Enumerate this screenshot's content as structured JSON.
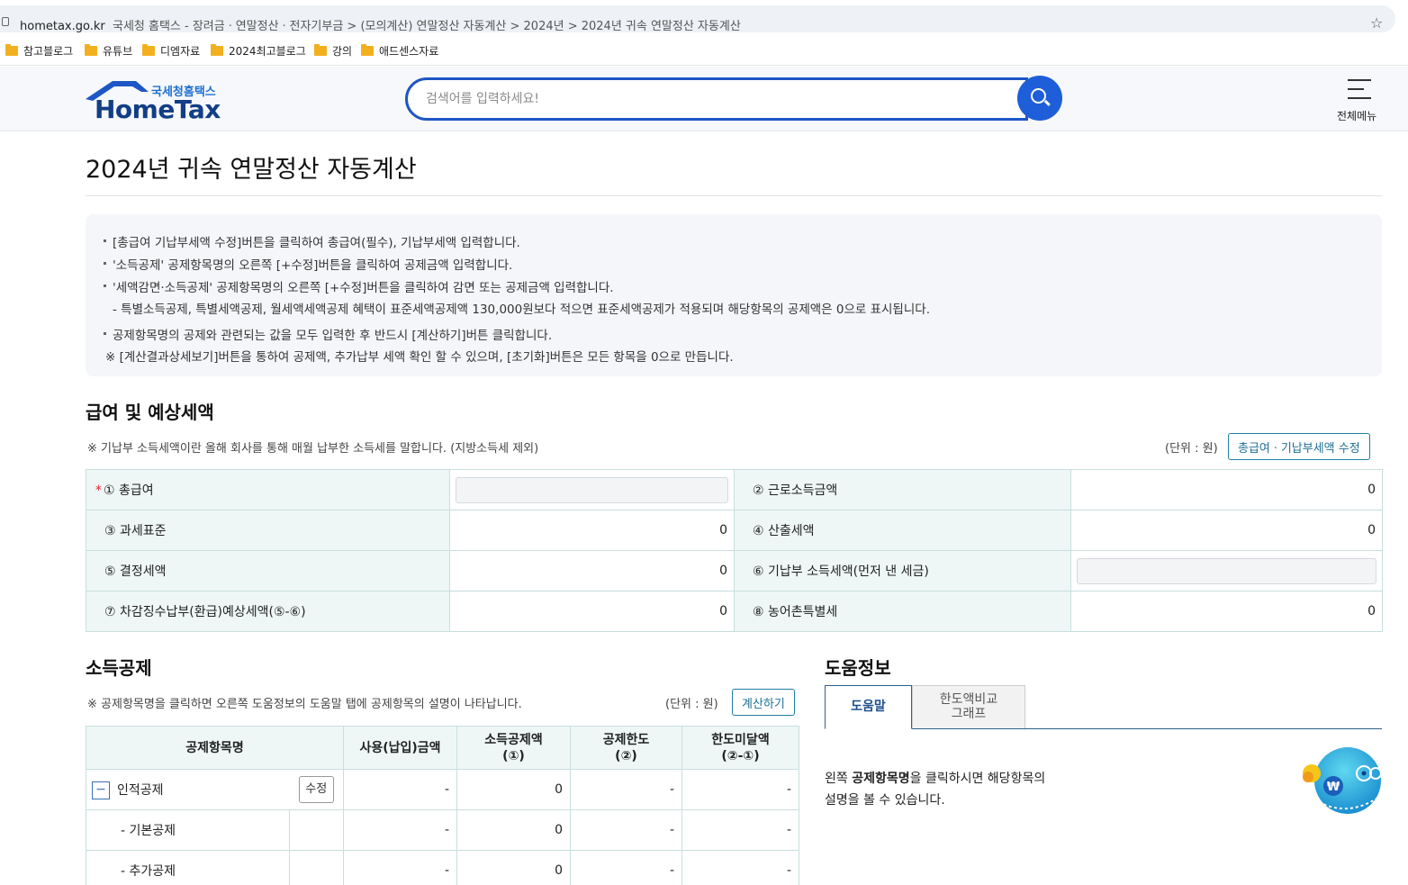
{
  "browser": {
    "host": "hometax.go.kr",
    "page_title": "국세청 홈택스 - 장려금ㆍ연말정산ㆍ전자기부금 > (모의계산) 연말정산 자동계산 > 2024년 > 2024년 귀속 연말정산 자동계산",
    "bookmarks": [
      "참고블로그",
      "유튜브",
      "디엠자료",
      "2024최고블로그",
      "강의",
      "애드센스자료"
    ]
  },
  "header": {
    "logo_ko": "국세청홈택스",
    "logo_en": "HomeTax",
    "search_placeholder": "검색어를 입력하세요!",
    "menu_label": "전체메뉴"
  },
  "page": {
    "title": "2024년 귀속 연말정산 자동계산"
  },
  "notice": {
    "lines": [
      "[총급여 기납부세액 수정]버튼을 클릭하여 총급여(필수), 기납부세액 입력합니다.",
      "'소득공제' 공제항목명의 오른쪽 [+수정]버튼을 클릭하여 공제금액 입력합니다.",
      "'세액감면·소득공제' 공제항목명의 오른쪽 [+수정]버튼을 클릭하여 감면 또는 공제금액 입력합니다.",
      "- 특별소득공제, 특별세액공제, 월세액세액공제 혜택이 표준세액공제액 130,000원보다 적으면 표준세액공제가 적용되며 해당항목의 공제액은 0으로 표시됩니다.",
      "공제항목명의 공제와 관련되는 값을 모두 입력한 후 반드시 [계산하기]버튼 클릭합니다.",
      "※ [계산결과상세보기]버튼을 통하여 공제액, 추가납부 세액 확인 할 수 있으며, [초기화]버튼은 모든 항목을 0으로 만듭니다."
    ]
  },
  "salary": {
    "title": "급여 및 예상세액",
    "note": "※ 기납부 소득세액이란 올해 회사를 통해 매월 납부한 소득세를 말합니다. (지방소득세 제외)",
    "unit": "(단위 : 원)",
    "edit_button": "총급여ㆍ기납부세액 수정",
    "required_mark": "*",
    "rows": [
      {
        "l1": "① 총급여",
        "v1": "",
        "l2": "② 근로소득금액",
        "v2": "0"
      },
      {
        "l1": "③ 과세표준",
        "v1": "0",
        "l2": "④ 산출세액",
        "v2": "0"
      },
      {
        "l1": "⑤ 결정세액",
        "v1": "0",
        "l2": "⑥ 기납부 소득세액(먼저 낸 세금)",
        "v2": ""
      },
      {
        "l1": "⑦ 차감징수납부(환급)예상세액(⑤-⑥)",
        "v1": "0",
        "l2": "⑧ 농어촌특별세",
        "v2": "0"
      }
    ]
  },
  "deduction": {
    "title": "소득공제",
    "note": "※ 공제항목명을 클릭하면 오른쪽 도움정보의 도움말 탭에 공제항목의 설명이 나타납니다.",
    "unit": "(단위 : 원)",
    "calc_button": "계산하기",
    "headers": [
      "공제항목명",
      "사용(납입)금액",
      "소득공제액\n(①)",
      "공제한도\n(②)",
      "한도미달액\n(②-①)"
    ],
    "rows": [
      {
        "toggle": "−",
        "name": "인적공제",
        "edit": "수정",
        "used": "-",
        "amount": "0",
        "limit": "-",
        "short": "-"
      },
      {
        "name": "- 기본공제",
        "used": "-",
        "amount": "0",
        "limit": "-",
        "short": "-"
      },
      {
        "name": "- 추가공제",
        "used": "-",
        "amount": "0",
        "limit": "-",
        "short": "-"
      }
    ]
  },
  "help": {
    "title": "도움정보",
    "tab_active": "도움말",
    "tab_inactive": "한도액비교\n그래프",
    "text_pre": "왼쪽 ",
    "text_bold": "공제항목명",
    "text_post": "을 클릭하시면 해당항목의",
    "text_line2": "설명을 볼 수 있습니다.",
    "mascot_mark": "₩"
  },
  "colors": {
    "brand_blue": "#1e56c5",
    "table_label_bg": "#eef7f6",
    "table_border": "#c8dedd",
    "required_red": "#e0202e"
  }
}
